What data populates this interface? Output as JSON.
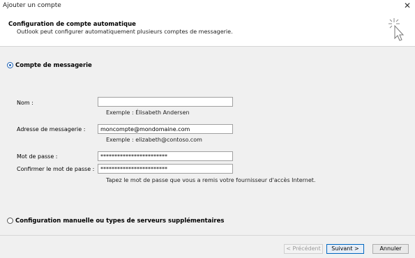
{
  "window": {
    "title": "Ajouter un compte",
    "close_glyph": "✕"
  },
  "header": {
    "title": "Configuration de compte automatique",
    "subtitle": "Outlook peut configurer automatiquement plusieurs comptes de messagerie.",
    "icon": "magic-wand-cursor-icon"
  },
  "options": {
    "email_account": {
      "label": "Compte de messagerie",
      "selected": true
    },
    "manual_config": {
      "label": "Configuration manuelle ou types de serveurs supplémentaires",
      "selected": false
    }
  },
  "form": {
    "name": {
      "label": "Nom :",
      "value": "",
      "example": "Exemple : Élisabeth Andersen"
    },
    "email": {
      "label": "Adresse de messagerie :",
      "value": "moncompte@mondomaine.com",
      "example": "Exemple : elizabeth@contoso.com"
    },
    "password": {
      "label": "Mot de passe :",
      "value": "************************"
    },
    "confirm_password": {
      "label": "Confirmer le mot de passe :",
      "value": "************************"
    },
    "password_hint": "Tapez le mot de passe que vous a remis votre fournisseur d'accès Internet."
  },
  "buttons": {
    "previous": "< Précédent",
    "next": "Suivant >",
    "cancel": "Annuler"
  },
  "colors": {
    "accent": "#0067c0",
    "background": "#f0f0f0",
    "header_bg": "#ffffff"
  }
}
